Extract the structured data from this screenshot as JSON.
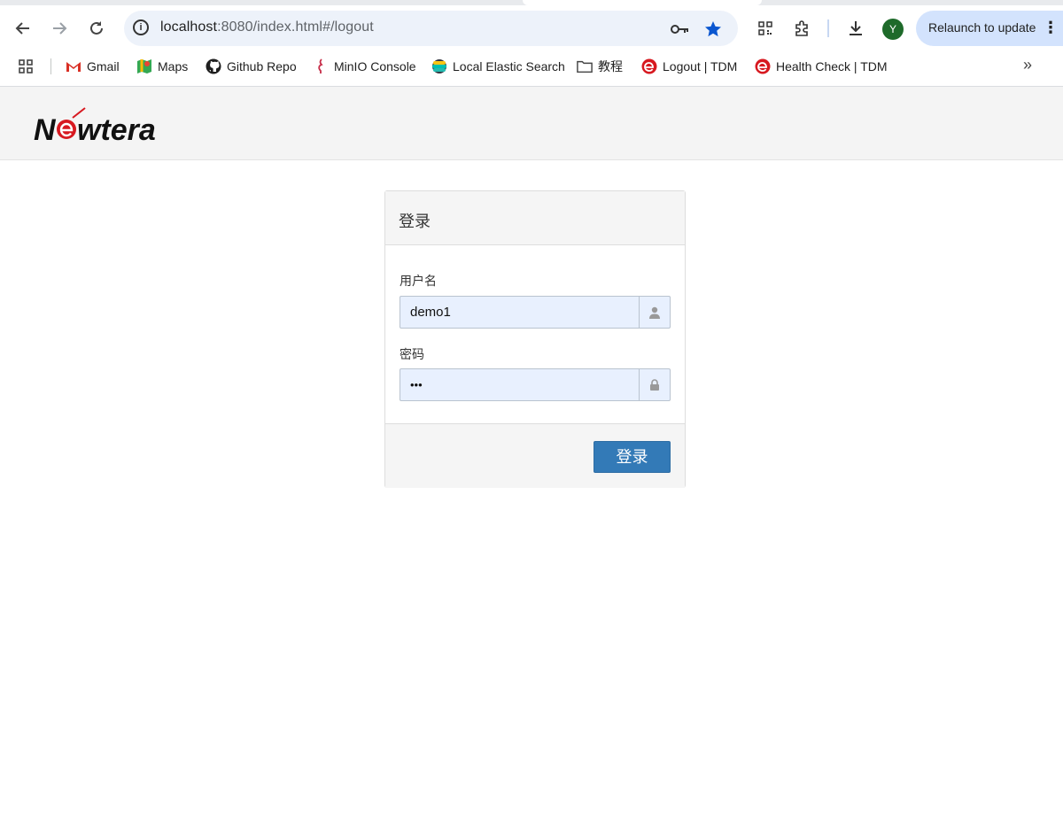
{
  "browser": {
    "url_host": "localhost",
    "url_rest": ":8080/index.html#/logout",
    "relaunch_label": "Relaunch to update",
    "profile_initial": "Y",
    "bookmarks": [
      {
        "label": "Gmail",
        "icon": "gmail-icon"
      },
      {
        "label": "Maps",
        "icon": "maps-icon"
      },
      {
        "label": "Github Repo",
        "icon": "github-icon"
      },
      {
        "label": "MinIO Console",
        "icon": "minio-icon"
      },
      {
        "label": "Local Elastic Search",
        "icon": "elastic-icon"
      },
      {
        "label": "教程",
        "icon": "folder-icon"
      },
      {
        "label": "Logout | TDM",
        "icon": "newtera-e-icon"
      },
      {
        "label": "Health Check | TDM",
        "icon": "newtera-e-icon"
      }
    ]
  },
  "app": {
    "logo_text": "Newtera"
  },
  "login": {
    "title": "登录",
    "username_label": "用户名",
    "username_value": "demo1",
    "password_label": "密码",
    "password_value": "•••",
    "submit_label": "登录"
  },
  "colors": {
    "primary_button": "#337ab7",
    "autofill_bg": "#e8f0fe",
    "logo_red": "#d71920"
  }
}
